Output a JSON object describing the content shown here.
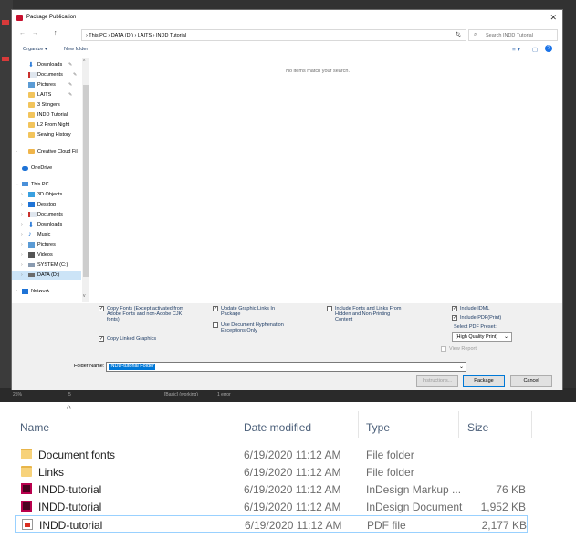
{
  "dialog": {
    "title": "Package Publication",
    "close": "✕",
    "nav": {
      "back": "←",
      "forward": "→",
      "up": "↑"
    },
    "address": "› This PC › DATA (D:) › LAITS › INDD Tutorial",
    "address_dropdown": "⌄",
    "refresh": "↻",
    "search_placeholder": "Search INDD Tutorial",
    "toolbar": {
      "organize": "Organize ▾",
      "new_folder": "New folder",
      "view": "≡ ▾",
      "pane": "▢",
      "help": "?"
    },
    "empty_message": "No items match your search.",
    "nav_items": [
      {
        "label": "Downloads",
        "pinned": true
      },
      {
        "label": "Documents",
        "pinned": true
      },
      {
        "label": "Pictures",
        "pinned": true
      },
      {
        "label": "LAITS",
        "pinned": true
      },
      {
        "label": "3 Stingers",
        "pinned": false
      },
      {
        "label": "INDD Tutorial",
        "pinned": false
      },
      {
        "label": "L2 Prom Night",
        "pinned": false
      },
      {
        "label": "Sewing History",
        "pinned": false
      },
      {
        "label": "Creative Cloud Fil",
        "pinned": false
      },
      {
        "label": "OneDrive",
        "pinned": false
      },
      {
        "label": "This PC",
        "pinned": false
      },
      {
        "label": "3D Objects",
        "pinned": false
      },
      {
        "label": "Desktop",
        "pinned": false
      },
      {
        "label": "Documents",
        "pinned": false
      },
      {
        "label": "Downloads",
        "pinned": false
      },
      {
        "label": "Music",
        "pinned": false
      },
      {
        "label": "Pictures",
        "pinned": false
      },
      {
        "label": "Videos",
        "pinned": false
      },
      {
        "label": "SYSTEM (C:)",
        "pinned": false
      },
      {
        "label": "DATA (D:)",
        "pinned": false
      },
      {
        "label": "Network",
        "pinned": false
      }
    ],
    "options": {
      "copy_fonts": {
        "label": "Copy Fonts (Except activated from Adobe Fonts and non-Adobe CJK fonts)",
        "checked": true
      },
      "copy_linked": {
        "label": "Copy Linked Graphics",
        "checked": true
      },
      "update_links": {
        "label": "Update Graphic Links In Package",
        "checked": true
      },
      "hyphenation": {
        "label": "Use Document Hyphenation Exceptions Only",
        "checked": false
      },
      "include_hidden": {
        "label": "Include Fonts and Links From Hidden and Non-Printing Content",
        "checked": false
      },
      "include_idml": {
        "label": "Include IDML",
        "checked": true
      },
      "include_pdf": {
        "label": "Include PDF(Print)",
        "checked": true
      },
      "pdf_preset_label": "Select PDF Preset:",
      "pdf_preset_value": "[High Quality Print]",
      "view_report": {
        "label": "View Report",
        "checked": false
      }
    },
    "folder_name_label": "Folder Name:",
    "folder_name_value": "INDD-tutorial Folder",
    "buttons": {
      "instructions": "Instructions...",
      "package": "Package",
      "cancel": "Cancel"
    }
  },
  "app_status": {
    "zoom": "25%",
    "page": "5",
    "mode": "[Basic] (working)",
    "errors": "1 error"
  },
  "explorer": {
    "columns": {
      "name": "Name",
      "date": "Date modified",
      "type": "Type",
      "size": "Size"
    },
    "rows": [
      {
        "name": "Document fonts",
        "date": "6/19/2020 11:12 AM",
        "type": "File folder",
        "size": "",
        "icon": "folder-icon"
      },
      {
        "name": "Links",
        "date": "6/19/2020 11:12 AM",
        "type": "File folder",
        "size": "",
        "icon": "folder-icon"
      },
      {
        "name": "INDD-tutorial",
        "date": "6/19/2020 11:12 AM",
        "type": "InDesign Markup ...",
        "size": "76 KB",
        "icon": "indesign-icon"
      },
      {
        "name": "INDD-tutorial",
        "date": "6/19/2020 11:12 AM",
        "type": "InDesign Document",
        "size": "1,952 KB",
        "icon": "indesign-icon"
      },
      {
        "name": "INDD-tutorial",
        "date": "6/19/2020 11:12 AM",
        "type": "PDF file",
        "size": "2,177 KB",
        "icon": "pdf-icon"
      }
    ]
  }
}
